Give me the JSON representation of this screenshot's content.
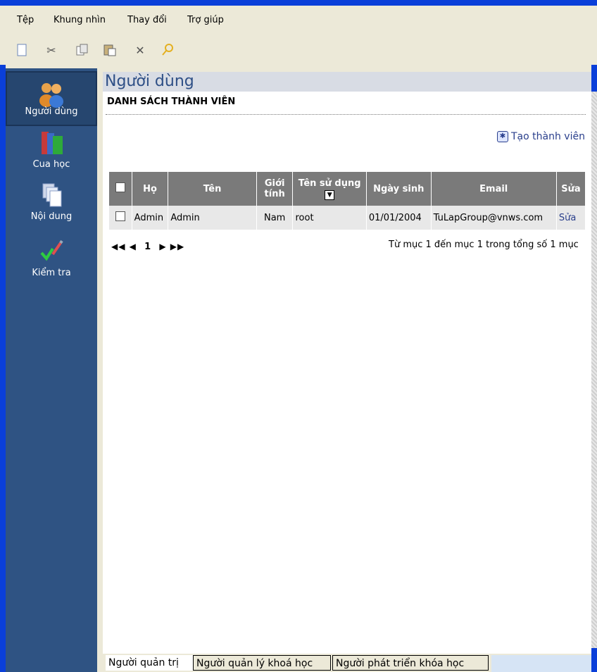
{
  "menu": [
    "Tệp",
    "Khung nhìn",
    "Thay đổi",
    "Trợ giúp"
  ],
  "toolbar": [
    "new-file-icon",
    "cut-icon",
    "copy-icon",
    "paste-icon",
    "delete-icon",
    "find-icon"
  ],
  "sidebar": {
    "items": [
      {
        "label": "Người dùng",
        "icon": "users-icon",
        "active": true
      },
      {
        "label": "Cua học",
        "icon": "books-icon",
        "active": false
      },
      {
        "label": "Nội dung",
        "icon": "documents-icon",
        "active": false
      },
      {
        "label": "Kiểm tra",
        "icon": "check-pencil-icon",
        "active": false
      }
    ]
  },
  "page": {
    "title": "Người dùng",
    "section_title": "DANH SÁCH THÀNH VIÊN",
    "create_link": "Tạo thành viên"
  },
  "table": {
    "headers": [
      "",
      "Họ",
      "Tên",
      "Giới tính",
      "Tên sử dụng",
      "Ngày sinh",
      "Email",
      "Sửa"
    ],
    "rows": [
      [
        "",
        "Admin",
        "Admin",
        "Nam",
        "root",
        "01/01/2004",
        "TuLapGroup@vnws.com",
        "Sửa"
      ]
    ]
  },
  "pager": {
    "first": "◀◀",
    "prev": "◀",
    "page": "1",
    "next": "▶",
    "last": "▶▶",
    "info": "Từ mục 1 đến mục 1 trong tổng số 1 mục"
  },
  "tabs": [
    "Người quản trị",
    "Người quản lý khoá học",
    "Người phát triển khóa học"
  ],
  "colors": {
    "sidebar": "#2f5383",
    "header": "#7a7a7a",
    "link": "#2a3f8c"
  }
}
